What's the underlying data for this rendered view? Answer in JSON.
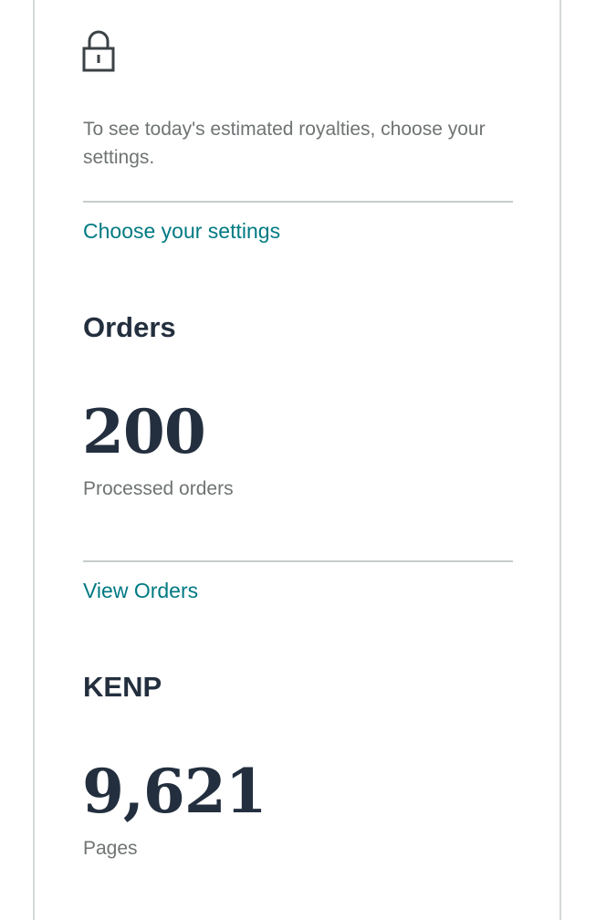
{
  "royalties": {
    "lock_icon": "lock-icon",
    "message": "To see today's estimated royalties, choose your settings.",
    "link_label": "Choose your settings"
  },
  "orders": {
    "heading": "Orders",
    "value": "200",
    "label": "Processed orders",
    "link_label": "View Orders"
  },
  "kenp": {
    "heading": "KENP",
    "value": "9,621",
    "label": "Pages"
  },
  "colors": {
    "text_dark": "#232f3e",
    "text_muted": "#6f7373",
    "link": "#007a82",
    "divider": "#c7cbcb",
    "card_border": "#d5d9d9"
  }
}
